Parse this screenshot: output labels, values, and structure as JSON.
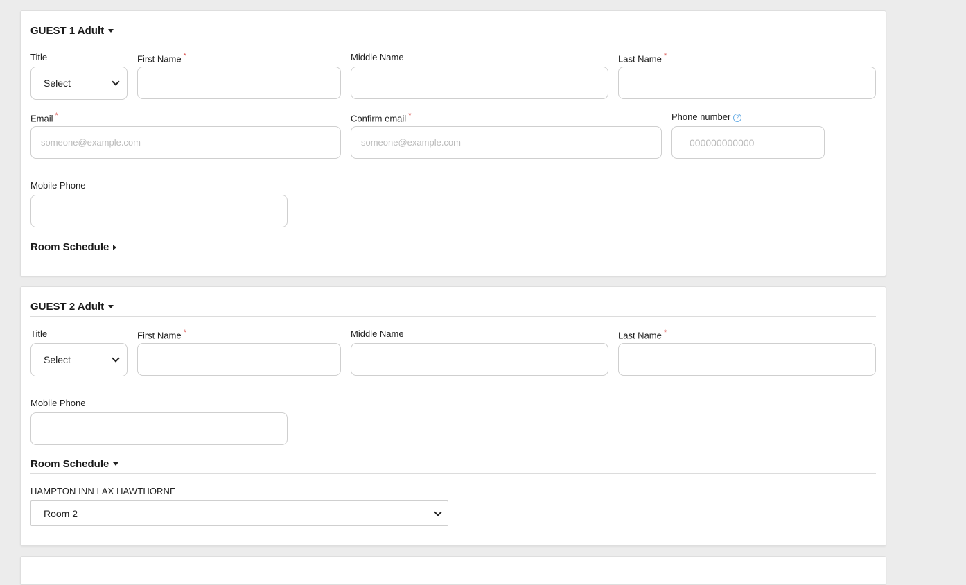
{
  "guest1": {
    "heading": "GUEST 1 Adult",
    "title_label": "Title",
    "title_value": "Select",
    "first_name_label": "First Name",
    "middle_name_label": "Middle Name",
    "last_name_label": "Last Name",
    "email_label": "Email",
    "email_placeholder": "someone@example.com",
    "confirm_email_label": "Confirm email",
    "confirm_email_placeholder": "someone@example.com",
    "phone_label": "Phone number",
    "phone_placeholder": "000000000000",
    "mobile_label": "Mobile Phone",
    "room_schedule": "Room Schedule",
    "required_mark": "*",
    "help_glyph": "?"
  },
  "guest2": {
    "heading": "GUEST 2 Adult",
    "title_label": "Title",
    "title_value": "Select",
    "first_name_label": "First Name",
    "middle_name_label": "Middle Name",
    "last_name_label": "Last Name",
    "mobile_label": "Mobile Phone",
    "room_schedule": "Room Schedule",
    "hotel_name": "HAMPTON INN LAX HAWTHORNE",
    "room_value": "Room 2",
    "required_mark": "*"
  }
}
